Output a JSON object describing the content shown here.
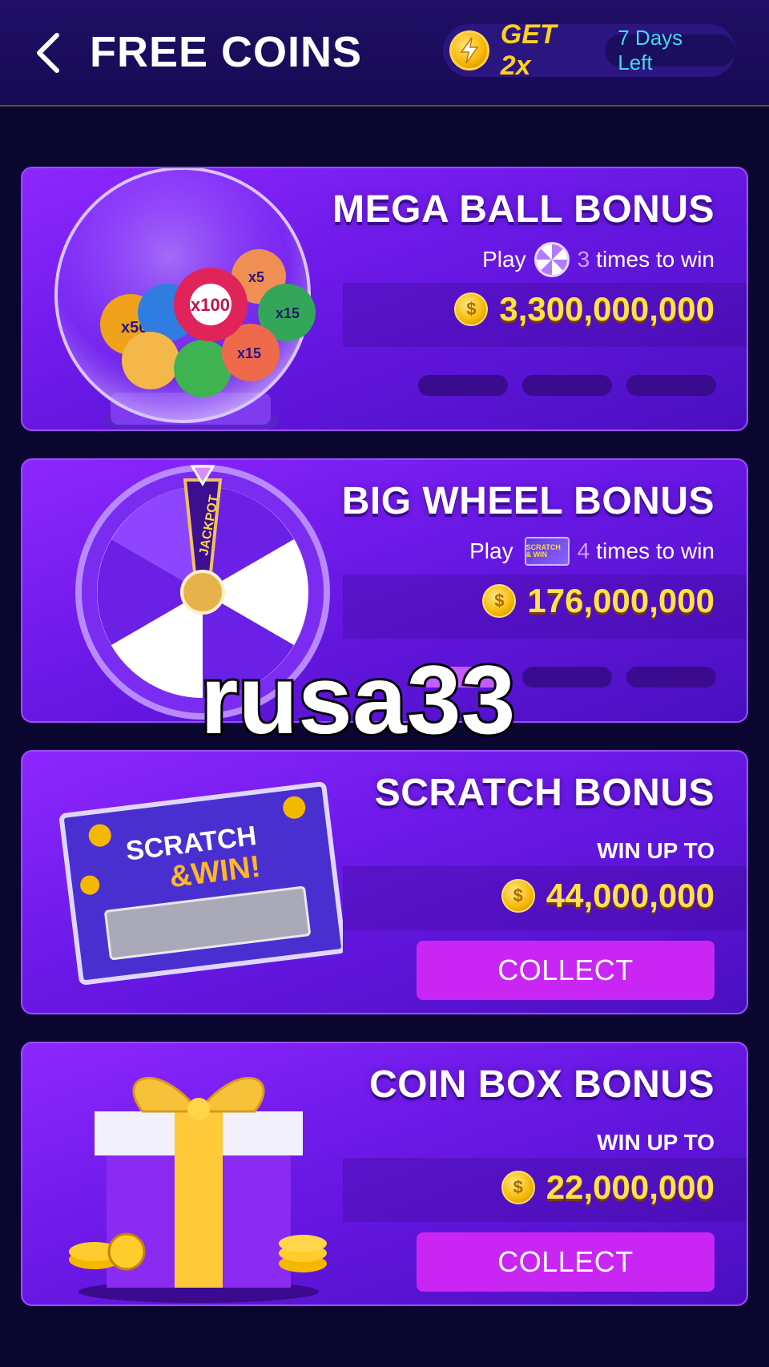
{
  "header": {
    "title": "FREE COINS",
    "boost_label": "GET 2x",
    "days_left": "7 Days Left"
  },
  "cards": [
    {
      "title": "MEGA BALL BONUS",
      "play_text": "Play",
      "play_count": "3",
      "play_suffix": "times to win",
      "prize": "3,300,000,000",
      "art_labels": [
        "x100",
        "x5",
        "x15",
        "x15",
        "x50",
        "x5"
      ]
    },
    {
      "title": "BIG WHEEL BONUS",
      "play_text": "Play",
      "play_count": "4",
      "play_suffix": "times to win",
      "prize": "176,000,000",
      "art_labels": [
        "JACKPOT"
      ],
      "mini_icon_text": "SCRATCH & WIN"
    },
    {
      "title": "SCRATCH BONUS",
      "win_up_to": "WIN UP TO",
      "prize": "44,000,000",
      "collect_label": "COLLECT",
      "art_labels": [
        "SCRATCH",
        "&WIN!"
      ]
    },
    {
      "title": "COIN BOX BONUS",
      "win_up_to": "WIN UP TO",
      "prize": "22,000,000",
      "collect_label": "COLLECT"
    }
  ],
  "watermark": "rusa33",
  "colors": {
    "background": "#0b0630",
    "card": "#7a1ff2",
    "prize_text": "#ffe14a",
    "collect_button": "#c926f4",
    "days_badge_text": "#3fd8f0"
  },
  "icons": [
    "chevron-left-icon",
    "lightning-coin-icon",
    "gold-coin-icon",
    "mini-wheel-icon",
    "mini-scratch-icon"
  ]
}
